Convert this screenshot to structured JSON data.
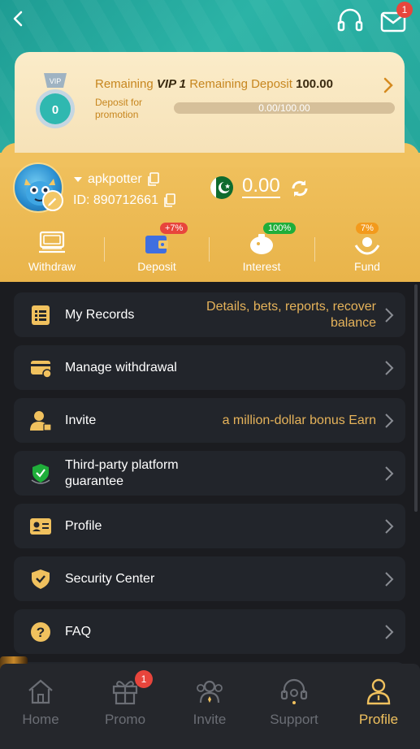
{
  "header": {
    "mail_badge": "1"
  },
  "vip": {
    "medal_level": "VIP",
    "medal_number": "0",
    "remaining_label": "Remaining",
    "level": "VIP 1",
    "remaining_deposit_label": "Remaining Deposit",
    "deposit_amount": "100.00",
    "sub_label": "Deposit for promotion",
    "progress_text": "0.00/100.00",
    "progress": 0
  },
  "user": {
    "username": "apkpotter",
    "id": "ID: 890712661",
    "balance": "0.00"
  },
  "actions": [
    {
      "label": "Withdraw",
      "badge": "",
      "icon": "withdraw-icon"
    },
    {
      "label": "Deposit",
      "badge": "+7%",
      "badge_color": "#e8453c",
      "icon": "wallet-icon"
    },
    {
      "label": "Interest",
      "badge": "100%",
      "badge_color": "#1fae3a",
      "icon": "piggy-bank-icon"
    },
    {
      "label": "Fund",
      "badge": "7%",
      "badge_color": "#f39a1c",
      "icon": "fund-hands-icon"
    }
  ],
  "menu": [
    {
      "label": "My Records",
      "desc": "Details, bets, reports, recover balance",
      "icon": "records-icon"
    },
    {
      "label": "Manage withdrawal",
      "desc": "",
      "icon": "card-icon"
    },
    {
      "label": "Invite",
      "desc": "a million-dollar bonus  Earn",
      "icon": "invite-user-icon"
    },
    {
      "label": "Third-party platform guarantee",
      "desc": "",
      "icon": "guarantee-shield-icon"
    },
    {
      "label": "Profile",
      "desc": "",
      "icon": "profile-card-icon"
    },
    {
      "label": "Security Center",
      "desc": "",
      "icon": "security-shield-icon"
    },
    {
      "label": "FAQ",
      "desc": "",
      "icon": "faq-icon"
    }
  ],
  "nav": [
    {
      "label": "Home",
      "icon": "home-icon",
      "badge": ""
    },
    {
      "label": "Promo",
      "icon": "gift-icon",
      "badge": "1"
    },
    {
      "label": "Invite",
      "icon": "invite-icon",
      "badge": ""
    },
    {
      "label": "Support",
      "icon": "support-icon",
      "badge": ""
    },
    {
      "label": "Profile",
      "icon": "profile-icon",
      "badge": "",
      "active": true
    }
  ],
  "colors": {
    "teal": "#25a79b",
    "gold": "#f0c15e",
    "accent_text": "#e6b35a",
    "dark_bg": "#1b1c20",
    "card_bg": "#22252b"
  }
}
